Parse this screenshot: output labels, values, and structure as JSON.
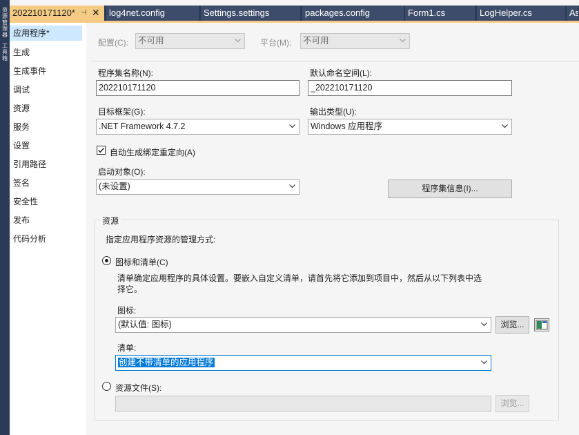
{
  "tool_strip": {
    "labels": [
      "资源管理器",
      "工具箱"
    ]
  },
  "tabs": [
    {
      "label": "202210171120*",
      "active": true
    },
    {
      "label": "log4net.config"
    },
    {
      "label": "Settings.settings"
    },
    {
      "label": "packages.config"
    },
    {
      "label": "Form1.cs"
    },
    {
      "label": "LogHelper.cs"
    },
    {
      "label": "As"
    }
  ],
  "tab_pin_glyph": "⊣",
  "tab_close_glyph": "✕",
  "nav": {
    "items": [
      "应用程序*",
      "生成",
      "生成事件",
      "调试",
      "资源",
      "服务",
      "设置",
      "引用路径",
      "签名",
      "安全性",
      "发布",
      "代码分析"
    ],
    "selected_index": 0
  },
  "config": {
    "config_label": "配置(C):",
    "config_value": "不可用",
    "platform_label": "平台(M):",
    "platform_value": "不可用"
  },
  "assembly": {
    "name_label": "程序集名称(N):",
    "name_value": "202210171120",
    "namespace_label": "默认命名空间(L):",
    "namespace_value": "_202210171120",
    "framework_label": "目标框架(G):",
    "framework_value": ".NET Framework 4.7.2",
    "output_label": "输出类型(U):",
    "output_value": "Windows 应用程序",
    "auto_redirect_label": "自动生成绑定重定向(A)",
    "auto_redirect_checked": true,
    "startup_label": "启动对象(O):",
    "startup_value": "(未设置)",
    "info_button": "程序集信息(I)..."
  },
  "resources": {
    "group_title": "资源",
    "description": "指定应用程序资源的管理方式:",
    "icon_manifest_radio": "图标和清单(C)",
    "icon_manifest_selected": true,
    "manifest_help_line1": "清单确定应用程序的具体设置。要嵌入自定义清单，请首先将它添加到项目中，然后从以下列表中选",
    "manifest_help_line2": "择它。",
    "icon_label": "图标:",
    "icon_value": "(默认值: 图标)",
    "browse_label": "浏览...",
    "manifest_label": "清单:",
    "manifest_value": "创建不带清单的应用程序",
    "resource_file_radio": "资源文件(S):",
    "resource_file_value": "",
    "browse_disabled_label": "浏览..."
  },
  "colors": {
    "active_tab": "#f5cc84",
    "tab_bg": "#3e4c6b",
    "nav_selected": "#cde8ff",
    "highlight": "#0078d7"
  }
}
